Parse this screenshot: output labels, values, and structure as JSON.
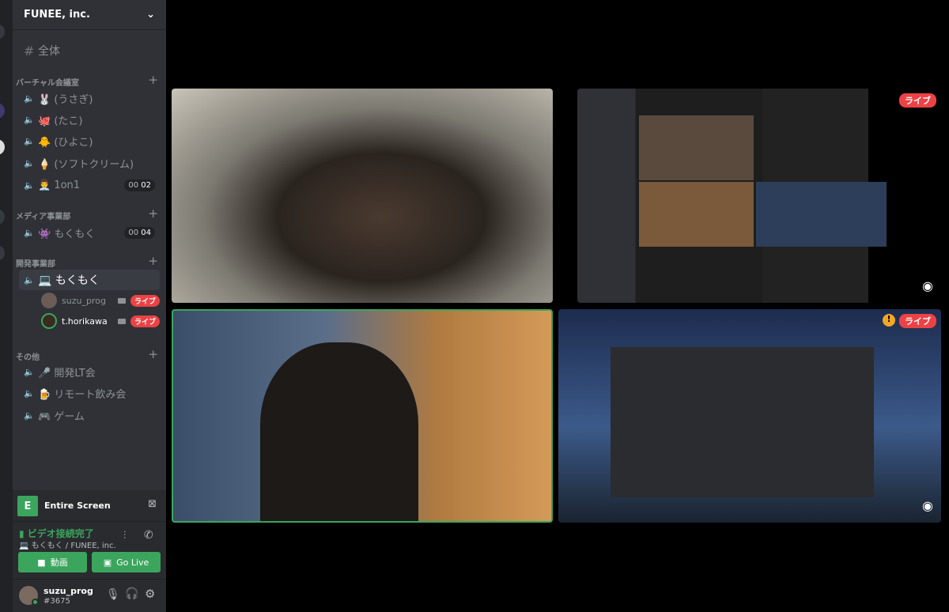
{
  "server": {
    "name": "FUNEE, inc."
  },
  "text_channel": "全体",
  "categories": [
    {
      "name": "バーチャル会議室",
      "channels": [
        {
          "label": "🐰 (うさぎ)"
        },
        {
          "label": "🐙 (たこ)"
        },
        {
          "label": "🐥 (ひよこ)"
        },
        {
          "label": "🍦 (ソフトクリーム)"
        },
        {
          "label": "👨‍💼 1on1",
          "count_a": "00",
          "count_b": "02"
        }
      ]
    },
    {
      "name": "メディア事業部",
      "channels": [
        {
          "label": "👾 もくもく",
          "count_a": "00",
          "count_b": "04"
        }
      ]
    },
    {
      "name": "開発事業部",
      "channels": [
        {
          "label": "💻 もくもく",
          "users": [
            {
              "name": "suzu_prog",
              "badge": "ライブ"
            },
            {
              "name": "t.horikawa",
              "badge": "ライブ"
            }
          ]
        }
      ]
    },
    {
      "name": "その他",
      "channels": [
        {
          "label": "🎤 開発LT会"
        },
        {
          "label": "🍺 リモート飲み会"
        },
        {
          "label": "🎮 ゲーム"
        }
      ]
    }
  ],
  "screen_share": {
    "label": "Entire Screen",
    "icon_letter": "E"
  },
  "voice": {
    "status": "ビデオ接続完了",
    "location": "💻 もくもく / FUNEE, inc.",
    "video_button": "動画",
    "golive_button": "Go Live"
  },
  "account": {
    "name": "suzu_prog",
    "tag": "#3675"
  },
  "tiles": [
    {
      "badge": ""
    },
    {
      "badge": "ライブ"
    },
    {
      "badge": ""
    },
    {
      "badge": "ライブ"
    }
  ],
  "colors": {
    "accent": "#3ba55d",
    "live": "#ed4245"
  }
}
